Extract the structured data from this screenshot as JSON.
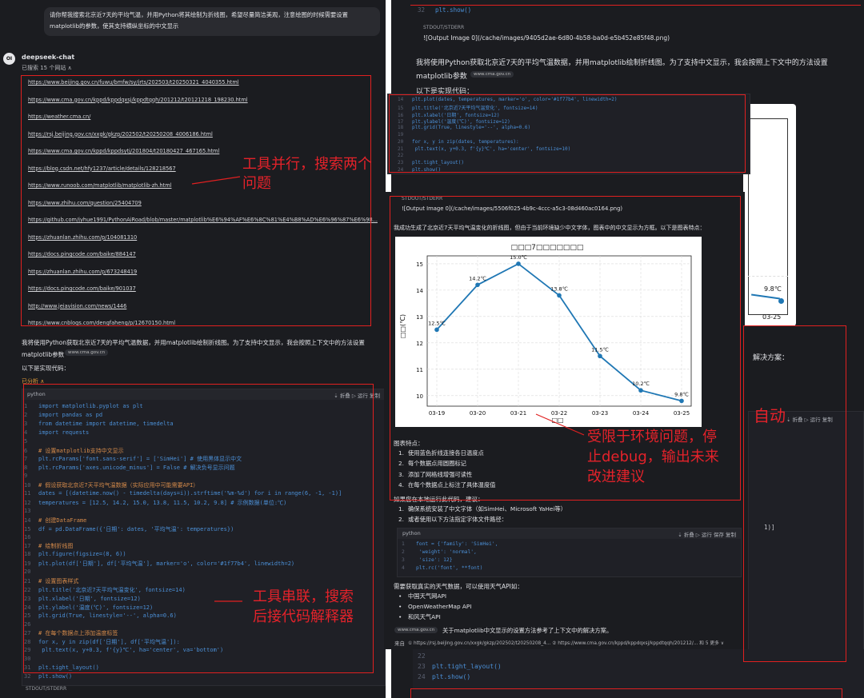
{
  "left": {
    "prompt": [
      "请你帮我搜索北京近7天的平均气温，并用Python将其绘制为折线图，希望尽量简洁美观，注意绘图的时候需要设置",
      "matplotlib的参数，使其支持横纵坐标的中文显示"
    ],
    "avatar": "OI",
    "bot_name": "deepseek-chat",
    "search_status": "已搜索 15 个网站 ∧",
    "links": [
      "https://www.beijing.gov.cn/fuwu/bmfw/sy/jrts/202503/t20250321_4040355.html",
      "https://www.cma.gov.cn/kppd/kppdqxsj/kppdtqqh/201212/t20121218_198230.html",
      "https://weather.cma.cn/",
      "https://rsj.beijing.gov.cn/xxgk/gkzp/202502/t20250208_4006186.html",
      "https://www.cma.gov.cn/kppd/kppdsytj/201804/t20180427_467165.html",
      "https://blog.csdn.net/hfy1237/article/details/128218567",
      "https://www.runoob.com/matplotlib/matplotlib-zh.html",
      "https://www.zhihu.com/question/25404709",
      "https://github.com/jyhue1991/PythonAiRoad/blob/master/matplotlib%E6%94%AF%E6%8C%81%E4%B8%AD%E6%96%87%E6%98...",
      "https://zhuanlan.zhihu.com/p/104081310",
      "https://docs.pingcode.com/baike/884147",
      "https://zhuanlan.zhihu.com/p/673248419",
      "https://docs.pingcode.com/baike/901037",
      "http://www.jeiavision.com/news/1446",
      "https://www.cnblogs.com/dengfaheng/p/12670150.html"
    ],
    "answer_lines": [
      "我将使用Python获取北京近7天的平均气温数据，并用matplotlib绘制折线图。为了支持中文显示，我会按照上下文中的方法设置",
      "matplotlib参数"
    ],
    "cite_pill": "www.cma.gov.cn",
    "code_label": "以下是实现代码：",
    "analysis_label": "已分析 ∧",
    "code_lang": "python",
    "code_actions": "⇣ 折叠  ▷ 运行  复制",
    "code": [
      "import matplotlib.pyplot as plt",
      "import pandas as pd",
      "from datetime import datetime, timedelta",
      "import requests",
      "",
      "# 设置matplotlib支持中文显示",
      "plt.rcParams['font.sans-serif'] = ['SimHei']  # 使用黑体显示中文",
      "plt.rcParams['axes.unicode_minus'] = False  # 解决负号显示问题",
      "",
      "# 假设获取北京近7天平均气温数据（实际应用中可能需要API）",
      "dates = [(datetime.now() - timedelta(days=i)).strftime('%m-%d') for i in range(6, -1, -1)]",
      "temperatures = [12.5, 14.2, 15.0, 13.8, 11.5, 10.2, 9.8]  # 示例数据(单位:℃)",
      "",
      "# 创建DataFrame",
      "df = pd.DataFrame({'日期': dates, '平均气温': temperatures})",
      "",
      "# 绘制折线图",
      "plt.figure(figsize=(8, 6))",
      "plt.plot(df['日期'], df['平均气温'], marker='o', color='#1f77b4', linewidth=2)",
      "",
      "# 设置图表样式",
      "plt.title('北京近7天平均气温变化', fontsize=14)",
      "plt.xlabel('日期', fontsize=12)",
      "plt.ylabel('温度(℃)', fontsize=12)",
      "plt.grid(True, linestyle='--', alpha=0.6)",
      "",
      "# 在每个数据点上添加温度标签",
      "for x, y in zip(df['日期'], df['平均气温']):",
      "    plt.text(x, y+0.3, f'{y}℃', ha='center', va='bottom')",
      "",
      "plt.tight_layout()",
      "plt.show()"
    ],
    "stdout_label": "STDOUT/STDERR"
  },
  "right": {
    "top_line_no": "32",
    "top_code": "plt.show()",
    "stdout_label": "STDOUT/STDERR",
    "output_image_1": "![Output Image 0](/cache/images/9405d2ae-6d80-4b58-ba0d-e5b452e85f48.png)",
    "answer_lines": [
      "我将使用Python获取北京近7天的平均气温数据，并用matplotlib绘制折线图。为了支持中文显示，我会按照上下文中的方法设置",
      "matplotlib参数"
    ],
    "cite_pill": "www.cma.gov.cn",
    "code_label": "以下是实现代码：",
    "partial_chart_label": "9.8℃",
    "partial_chart_tick": "03-25",
    "partial_text": "解决方案：",
    "bottom_lines": [
      {
        "no": "22",
        "code": ""
      },
      {
        "no": "23",
        "code": "plt.tight_layout()"
      },
      {
        "no": "24",
        "code": "plt.show()"
      }
    ],
    "side_code_end": "1)]",
    "side_actions": "⇣ 折叠  ▷ 运行  复制"
  },
  "overlay": {
    "code_lines": [
      {
        "no": "14",
        "code": "plt.plot(dates, temperatures, marker='o', color='#1f77b4', linewidth=2)"
      },
      {
        "no": "15",
        "code": "plt.title('北京近7天平均气温变化', fontsize=14)"
      },
      {
        "no": "16",
        "code": "plt.xlabel('日期', fontsize=12)"
      },
      {
        "no": "17",
        "code": "plt.ylabel('温度(℃)', fontsize=12)"
      },
      {
        "no": "18",
        "code": "plt.grid(True, linestyle='--', alpha=0.6)"
      },
      {
        "no": "19",
        "code": ""
      },
      {
        "no": "20",
        "code": "for x, y in zip(dates, temperatures):"
      },
      {
        "no": "21",
        "code": "    plt.text(x, y+0.3, f'{y}℃', ha='center', fontsize=10)"
      },
      {
        "no": "22",
        "code": ""
      },
      {
        "no": "23",
        "code": "plt.tight_layout()"
      },
      {
        "no": "24",
        "code": "plt.show()"
      }
    ],
    "stdout_label": "STDOUT/STDERR",
    "output_image": "![Output Image 0](/cache/images/5506f025-4b9c-4ccc-a5c3-08d460ac0164.png)",
    "intro": "我成功生成了北京近7天平均气温变化的折线图，但由于当前环境缺少中文字体，图表中的中文显示为方框。以下是图表特点：",
    "features_title": "图表特点：",
    "features": [
      "使用蓝色折线连接各日温度点",
      "每个数据点用圆圈标记",
      "添加了网格线增强可读性",
      "在每个数据点上标注了具体温度值"
    ],
    "advice_title": "如果您在本地运行此代码，建议：",
    "advice": [
      "确保系统安装了中文字体（如SimHei、Microsoft YaHei等）",
      "或者使用以下方法指定字体文件路径："
    ],
    "font_code_lang": "python",
    "font_code_actions": "⇣ 折叠  ▷ 运行  保存  复制",
    "font_code": [
      "font = {'family': 'SimHei',",
      "        'weight': 'normal',",
      "        'size': 12}",
      "plt.rc('font', **font)"
    ],
    "api_title": "需要获取真实的天气数据，可以使用天气API如：",
    "apis": [
      "中国天气网API",
      "OpenWeatherMap API",
      "和风天气API"
    ],
    "cite_pill": "www.cma.gov.cn",
    "cite_text": "关于matplotlib中文显示的设置方法参考了上下文中的解决方案。",
    "sources_label": "来自",
    "sources": "① https://rsj.beijing.gov.cn/xxgk/gkzp/202502/t20250208_4...   ② https://www.cma.gov.cn/kppd/kppdqxsj/kppdtqqh/201212/...  和 5 更多 ∨"
  },
  "annotations": {
    "parallel": [
      "工具并行，搜索两个",
      "问题"
    ],
    "serial": [
      "工具串联，搜索",
      "后接代码解释器"
    ],
    "limited": [
      "受限于环境问题，停",
      "止debug，输出未来",
      "改进建议"
    ],
    "auto": "自动"
  },
  "chart_data": {
    "type": "line",
    "title": "□□□7□□□□□□□",
    "xlabel": "□□",
    "ylabel": "□□(℃)",
    "categories": [
      "03-19",
      "03-20",
      "03-21",
      "03-22",
      "03-23",
      "03-24",
      "03-25"
    ],
    "series": [
      {
        "values": [
          12.5,
          14.2,
          15.0,
          13.8,
          11.5,
          10.2,
          9.8
        ]
      }
    ],
    "data_labels": [
      "12.5℃",
      "14.2℃",
      "15.0℃",
      "13.8℃",
      "11.5℃",
      "10.2℃",
      "9.8℃"
    ],
    "yticks": [
      "10",
      "11",
      "12",
      "13",
      "14",
      "15"
    ],
    "ylim": [
      9.6,
      15.3
    ],
    "grid": true,
    "line_color": "#1f77b4"
  }
}
